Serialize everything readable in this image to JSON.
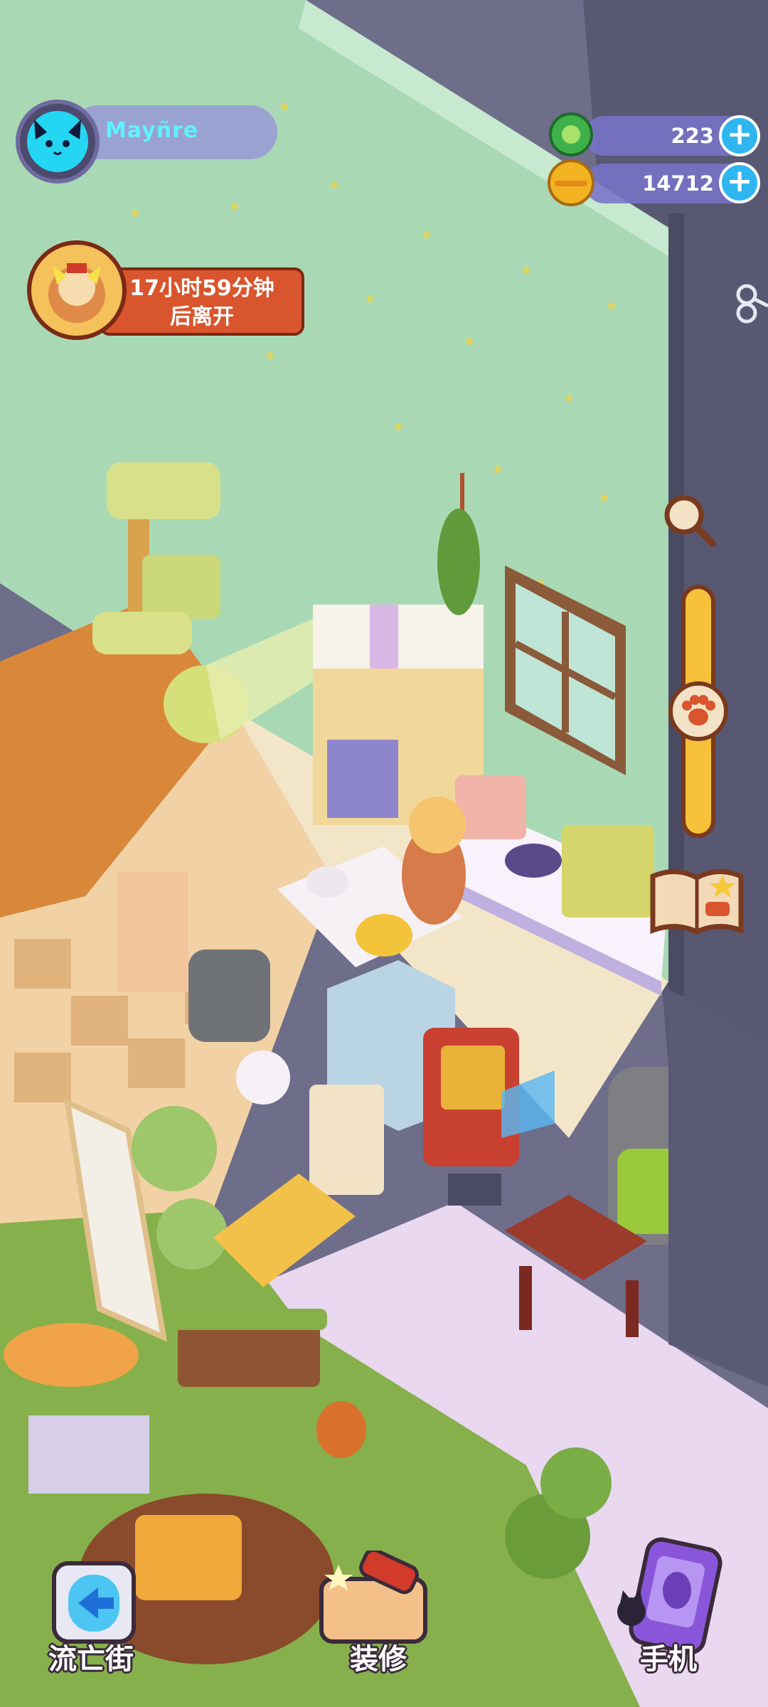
{
  "player": {
    "name": "Mayñre"
  },
  "currencies": [
    {
      "name": "green-gem",
      "value": "223",
      "color": "#3fb14a"
    },
    {
      "name": "gold-coin",
      "value": "14712",
      "color": "#f2b321"
    }
  ],
  "visitor": {
    "timer_line1": "17小时59分钟",
    "timer_line2": "后离开"
  },
  "bottom_bar": {
    "street_label": "流亡街",
    "decorate_label": "装修",
    "phone_label": "手机"
  },
  "colors": {
    "wall": "#a9d9b4",
    "floor_tile": "#f3e6c8",
    "rug": "#e9d8ef",
    "hud_pill": "#8f8cd6",
    "accent_orange": "#d9552d"
  }
}
